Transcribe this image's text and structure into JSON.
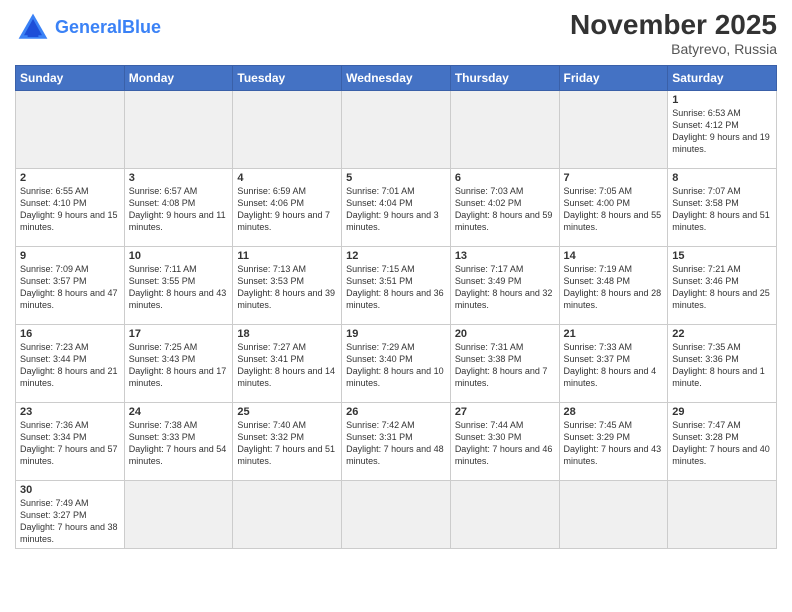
{
  "header": {
    "logo_general": "General",
    "logo_blue": "Blue",
    "month_title": "November 2025",
    "location": "Batyrevo, Russia"
  },
  "weekdays": [
    "Sunday",
    "Monday",
    "Tuesday",
    "Wednesday",
    "Thursday",
    "Friday",
    "Saturday"
  ],
  "weeks": [
    [
      {
        "day": "",
        "info": "",
        "empty": true
      },
      {
        "day": "",
        "info": "",
        "empty": true
      },
      {
        "day": "",
        "info": "",
        "empty": true
      },
      {
        "day": "",
        "info": "",
        "empty": true
      },
      {
        "day": "",
        "info": "",
        "empty": true
      },
      {
        "day": "",
        "info": "",
        "empty": true
      },
      {
        "day": "1",
        "info": "Sunrise: 6:53 AM\nSunset: 4:12 PM\nDaylight: 9 hours\nand 19 minutes."
      }
    ],
    [
      {
        "day": "2",
        "info": "Sunrise: 6:55 AM\nSunset: 4:10 PM\nDaylight: 9 hours\nand 15 minutes."
      },
      {
        "day": "3",
        "info": "Sunrise: 6:57 AM\nSunset: 4:08 PM\nDaylight: 9 hours\nand 11 minutes."
      },
      {
        "day": "4",
        "info": "Sunrise: 6:59 AM\nSunset: 4:06 PM\nDaylight: 9 hours\nand 7 minutes."
      },
      {
        "day": "5",
        "info": "Sunrise: 7:01 AM\nSunset: 4:04 PM\nDaylight: 9 hours\nand 3 minutes."
      },
      {
        "day": "6",
        "info": "Sunrise: 7:03 AM\nSunset: 4:02 PM\nDaylight: 8 hours\nand 59 minutes."
      },
      {
        "day": "7",
        "info": "Sunrise: 7:05 AM\nSunset: 4:00 PM\nDaylight: 8 hours\nand 55 minutes."
      },
      {
        "day": "8",
        "info": "Sunrise: 7:07 AM\nSunset: 3:58 PM\nDaylight: 8 hours\nand 51 minutes."
      }
    ],
    [
      {
        "day": "9",
        "info": "Sunrise: 7:09 AM\nSunset: 3:57 PM\nDaylight: 8 hours\nand 47 minutes."
      },
      {
        "day": "10",
        "info": "Sunrise: 7:11 AM\nSunset: 3:55 PM\nDaylight: 8 hours\nand 43 minutes."
      },
      {
        "day": "11",
        "info": "Sunrise: 7:13 AM\nSunset: 3:53 PM\nDaylight: 8 hours\nand 39 minutes."
      },
      {
        "day": "12",
        "info": "Sunrise: 7:15 AM\nSunset: 3:51 PM\nDaylight: 8 hours\nand 36 minutes."
      },
      {
        "day": "13",
        "info": "Sunrise: 7:17 AM\nSunset: 3:49 PM\nDaylight: 8 hours\nand 32 minutes."
      },
      {
        "day": "14",
        "info": "Sunrise: 7:19 AM\nSunset: 3:48 PM\nDaylight: 8 hours\nand 28 minutes."
      },
      {
        "day": "15",
        "info": "Sunrise: 7:21 AM\nSunset: 3:46 PM\nDaylight: 8 hours\nand 25 minutes."
      }
    ],
    [
      {
        "day": "16",
        "info": "Sunrise: 7:23 AM\nSunset: 3:44 PM\nDaylight: 8 hours\nand 21 minutes."
      },
      {
        "day": "17",
        "info": "Sunrise: 7:25 AM\nSunset: 3:43 PM\nDaylight: 8 hours\nand 17 minutes."
      },
      {
        "day": "18",
        "info": "Sunrise: 7:27 AM\nSunset: 3:41 PM\nDaylight: 8 hours\nand 14 minutes."
      },
      {
        "day": "19",
        "info": "Sunrise: 7:29 AM\nSunset: 3:40 PM\nDaylight: 8 hours\nand 10 minutes."
      },
      {
        "day": "20",
        "info": "Sunrise: 7:31 AM\nSunset: 3:38 PM\nDaylight: 8 hours\nand 7 minutes."
      },
      {
        "day": "21",
        "info": "Sunrise: 7:33 AM\nSunset: 3:37 PM\nDaylight: 8 hours\nand 4 minutes."
      },
      {
        "day": "22",
        "info": "Sunrise: 7:35 AM\nSunset: 3:36 PM\nDaylight: 8 hours\nand 1 minute."
      }
    ],
    [
      {
        "day": "23",
        "info": "Sunrise: 7:36 AM\nSunset: 3:34 PM\nDaylight: 7 hours\nand 57 minutes."
      },
      {
        "day": "24",
        "info": "Sunrise: 7:38 AM\nSunset: 3:33 PM\nDaylight: 7 hours\nand 54 minutes."
      },
      {
        "day": "25",
        "info": "Sunrise: 7:40 AM\nSunset: 3:32 PM\nDaylight: 7 hours\nand 51 minutes."
      },
      {
        "day": "26",
        "info": "Sunrise: 7:42 AM\nSunset: 3:31 PM\nDaylight: 7 hours\nand 48 minutes."
      },
      {
        "day": "27",
        "info": "Sunrise: 7:44 AM\nSunset: 3:30 PM\nDaylight: 7 hours\nand 46 minutes."
      },
      {
        "day": "28",
        "info": "Sunrise: 7:45 AM\nSunset: 3:29 PM\nDaylight: 7 hours\nand 43 minutes."
      },
      {
        "day": "29",
        "info": "Sunrise: 7:47 AM\nSunset: 3:28 PM\nDaylight: 7 hours\nand 40 minutes."
      }
    ],
    [
      {
        "day": "30",
        "info": "Sunrise: 7:49 AM\nSunset: 3:27 PM\nDaylight: 7 hours\nand 38 minutes."
      },
      {
        "day": "",
        "info": "",
        "empty": true
      },
      {
        "day": "",
        "info": "",
        "empty": true
      },
      {
        "day": "",
        "info": "",
        "empty": true
      },
      {
        "day": "",
        "info": "",
        "empty": true
      },
      {
        "day": "",
        "info": "",
        "empty": true
      },
      {
        "day": "",
        "info": "",
        "empty": true
      }
    ]
  ]
}
